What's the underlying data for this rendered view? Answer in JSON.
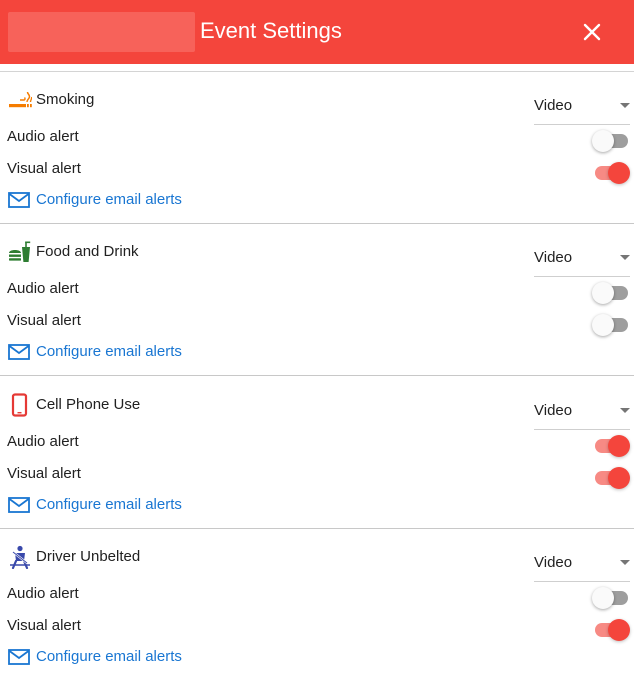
{
  "header": {
    "title": "Event Settings",
    "close_icon": "close-icon"
  },
  "colors": {
    "header_bg": "#f4453c",
    "toggle_on": "#f4453c",
    "link": "#1976d2"
  },
  "sections": [
    {
      "name": "Smoking",
      "icon": "smoking-icon",
      "icon_color": "#f57c00",
      "select_value": "Video",
      "audio_label": "Audio alert",
      "audio_on": false,
      "visual_label": "Visual alert",
      "visual_on": true,
      "email_label": "Configure email alerts"
    },
    {
      "name": "Food and Drink",
      "icon": "food-drink-icon",
      "icon_color": "#2e7d32",
      "select_value": "Video",
      "audio_label": "Audio alert",
      "audio_on": false,
      "visual_label": "Visual alert",
      "visual_on": false,
      "email_label": "Configure email alerts"
    },
    {
      "name": "Cell Phone Use",
      "icon": "cell-phone-icon",
      "icon_color": "#e53935",
      "select_value": "Video",
      "audio_label": "Audio alert",
      "audio_on": true,
      "visual_label": "Visual alert",
      "visual_on": true,
      "email_label": "Configure email alerts"
    },
    {
      "name": "Driver Unbelted",
      "icon": "seatbelt-icon",
      "icon_color": "#3949ab",
      "select_value": "Video",
      "audio_label": "Audio alert",
      "audio_on": false,
      "visual_label": "Visual alert",
      "visual_on": true,
      "email_label": "Configure email alerts"
    }
  ]
}
